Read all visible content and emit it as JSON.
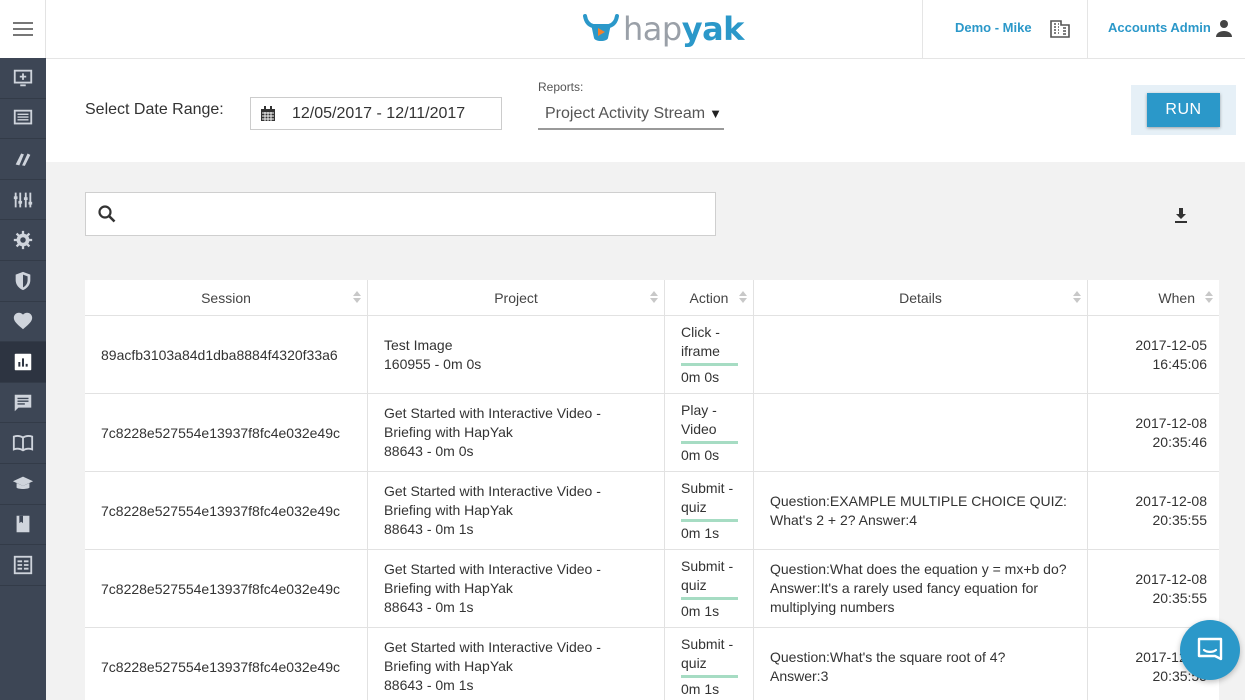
{
  "app": {
    "logo_hap": "hap",
    "logo_yak": "yak",
    "brand_color": "#2b98c9",
    "sidebar_color": "#3d4655"
  },
  "header": {
    "account": "Demo - Mike",
    "user": "Accounts Admin"
  },
  "sidebar": {
    "items": [
      {
        "icon": "add-project-icon"
      },
      {
        "icon": "projects-list-icon"
      },
      {
        "icon": "tag-icon"
      },
      {
        "icon": "sliders-icon"
      },
      {
        "icon": "gear-icon"
      },
      {
        "icon": "shield-icon"
      },
      {
        "icon": "heart-icon"
      },
      {
        "icon": "reports-icon",
        "active": true
      },
      {
        "icon": "chat-icon"
      },
      {
        "icon": "book-icon"
      },
      {
        "icon": "graduation-cap-icon"
      },
      {
        "icon": "bookmark-icon"
      },
      {
        "icon": "templates-icon"
      }
    ]
  },
  "filters": {
    "date_label": "Select Date Range:",
    "date_value": "12/05/2017 - 12/11/2017",
    "reports_label": "Reports:",
    "report_value": "Project Activity Stream",
    "run_label": "RUN"
  },
  "search": {
    "placeholder": ""
  },
  "table": {
    "headers": [
      "Session",
      "Project",
      "Action",
      "Details",
      "When"
    ],
    "rows": [
      {
        "session": "89acfb3103a84d1dba8884f4320f33a6",
        "project_name": "Test Image",
        "project_meta": "160955 - 0m 0s",
        "action": "Click - iframe",
        "action_time": "0m 0s",
        "details": "",
        "date": "2017-12-05",
        "time": "16:45:06"
      },
      {
        "session": "7c8228e527554e13937f8fc4e032e49c",
        "project_name": "Get Started with Interactive Video - Briefing with HapYak",
        "project_meta": "88643 - 0m 0s",
        "action": "Play - Video",
        "action_time": "0m 0s",
        "details": "",
        "date": "2017-12-08",
        "time": "20:35:46"
      },
      {
        "session": "7c8228e527554e13937f8fc4e032e49c",
        "project_name": "Get Started with Interactive Video - Briefing with HapYak",
        "project_meta": "88643 - 0m 1s",
        "action": "Submit - quiz",
        "action_time": "0m 1s",
        "details": "Question:EXAMPLE MULTIPLE CHOICE QUIZ: What's 2 + 2? Answer:4",
        "date": "2017-12-08",
        "time": "20:35:55"
      },
      {
        "session": "7c8228e527554e13937f8fc4e032e49c",
        "project_name": "Get Started with Interactive Video - Briefing with HapYak",
        "project_meta": "88643 - 0m 1s",
        "action": "Submit - quiz",
        "action_time": "0m 1s",
        "details": "Question:What does the equation y = mx+b do? Answer:It's a rarely used fancy equation for multiplying numbers",
        "date": "2017-12-08",
        "time": "20:35:55"
      },
      {
        "session": "7c8228e527554e13937f8fc4e032e49c",
        "project_name": "Get Started with Interactive Video - Briefing with HapYak",
        "project_meta": "88643 - 0m 1s",
        "action": "Submit - quiz",
        "action_time": "0m 1s",
        "details": "Question:What's the square root of 4? Answer:3",
        "date": "2017-12-08",
        "time": "20:35:55"
      }
    ]
  }
}
